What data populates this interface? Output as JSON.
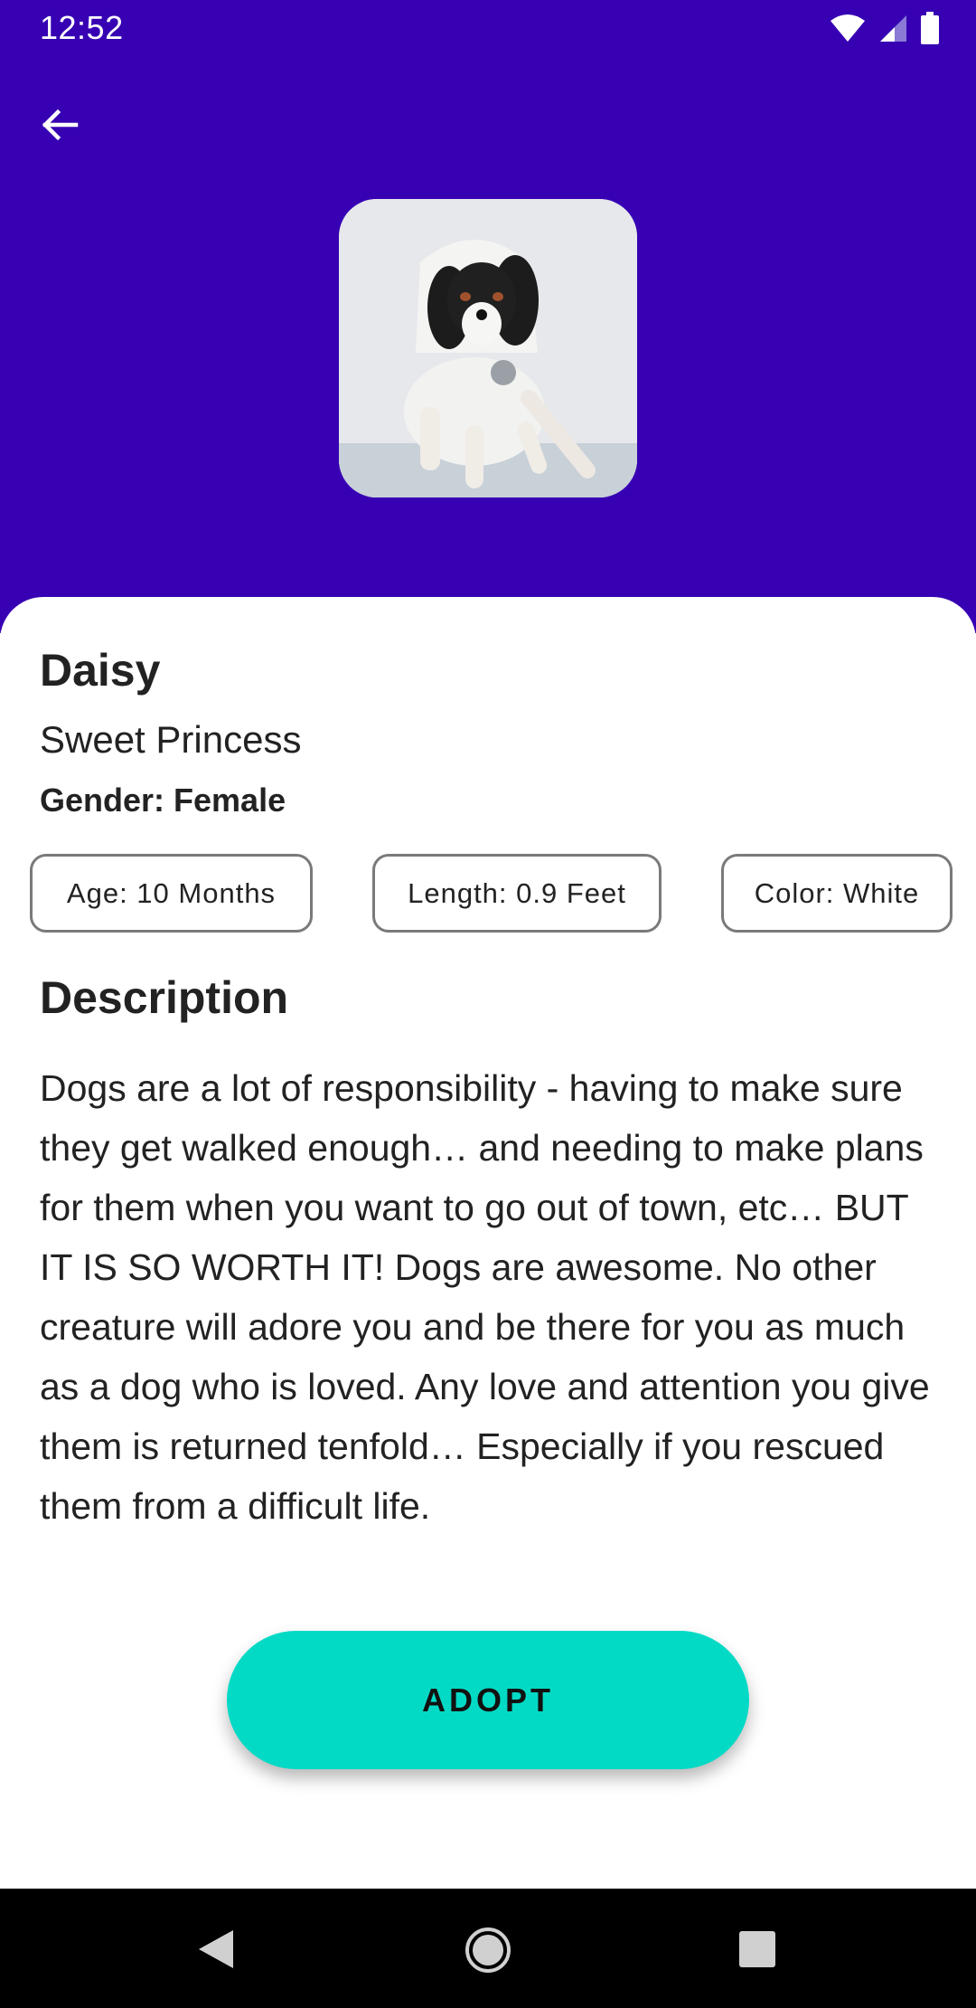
{
  "status_bar": {
    "time": "12:52",
    "icons": [
      "wifi-icon",
      "signal-icon",
      "battery-icon"
    ]
  },
  "header": {
    "back_icon": "arrow-left-icon",
    "background_color": "#3700b3"
  },
  "pet": {
    "name": "Daisy",
    "subtitle": "Sweet Princess",
    "gender": "Gender: Female",
    "chips": {
      "age": "Age: 10 Months",
      "length": "Length: 0.9 Feet",
      "color": "Color: White"
    }
  },
  "description": {
    "heading": "Description",
    "text": "Dogs are a lot of responsibility - having to make sure they get walked enough… and needing to make plans for them when you want to go out of town, etc… BUT IT IS SO WORTH IT! Dogs are awesome. No other creature will adore you and be there for you as much as a dog who is loved. Any love and attention you give them is returned tenfold… Especially if you rescued them from a difficult life."
  },
  "actions": {
    "adopt_label": "ADOPT",
    "accent_color": "#03dac5"
  },
  "nav_bar": {
    "icons": [
      "nav-back-icon",
      "nav-home-icon",
      "nav-recents-icon"
    ]
  }
}
